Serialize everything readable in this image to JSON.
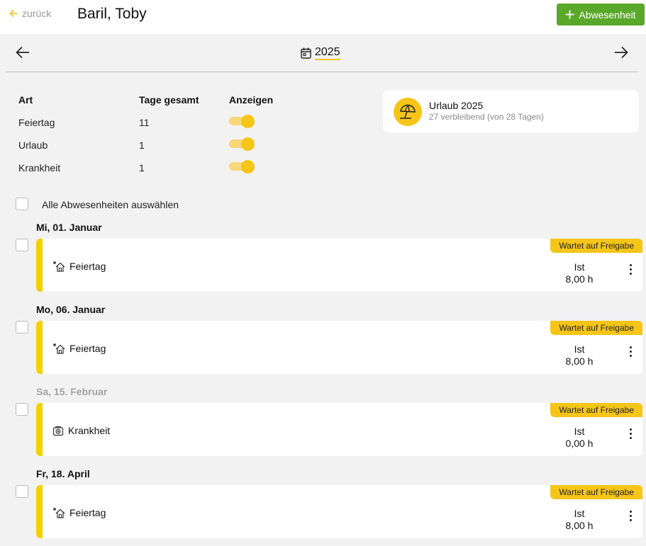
{
  "header": {
    "back_label": "zurück",
    "title": "Baril, Toby",
    "add_label": "Abwesenheit"
  },
  "yearnav": {
    "year": "2025"
  },
  "summary": {
    "headers": {
      "type": "Art",
      "total": "Tage gesamt",
      "show": "Anzeigen"
    },
    "rows": [
      {
        "type": "Feiertag",
        "total": "11",
        "visible": true
      },
      {
        "type": "Urlaub",
        "total": "1",
        "visible": true
      },
      {
        "type": "Krankheit",
        "total": "1",
        "visible": true
      }
    ]
  },
  "vacation_card": {
    "title": "Urlaub 2025",
    "subtitle": "27 verbleibend (von 28 Tagen)"
  },
  "select_all_label": "Alle Abwesenheiten auswählen",
  "entries": [
    {
      "date": "Mi, 01. Januar",
      "muted": false,
      "type": "Feiertag",
      "icon": "holiday-house-icon",
      "status": "Wartet auf Freigabe",
      "ist_label": "Ist",
      "hours": "8,00 h"
    },
    {
      "date": "Mo, 06. Januar",
      "muted": false,
      "type": "Feiertag",
      "icon": "holiday-house-icon",
      "status": "Wartet auf Freigabe",
      "ist_label": "Ist",
      "hours": "8,00 h"
    },
    {
      "date": "Sa, 15. Februar",
      "muted": true,
      "type": "Krankheit",
      "icon": "sick-icon",
      "status": "Wartet auf Freigabe",
      "ist_label": "Ist",
      "hours": "0,00 h"
    },
    {
      "date": "Fr, 18. April",
      "muted": false,
      "type": "Feiertag",
      "icon": "holiday-house-icon",
      "status": "Wartet auf Freigabe",
      "ist_label": "Ist",
      "hours": "8,00 h"
    }
  ],
  "colors": {
    "accent": "#f5c518",
    "primary_button": "#5aa82a",
    "entry_stripe": "#f5d000",
    "background": "#f2f2f2"
  }
}
